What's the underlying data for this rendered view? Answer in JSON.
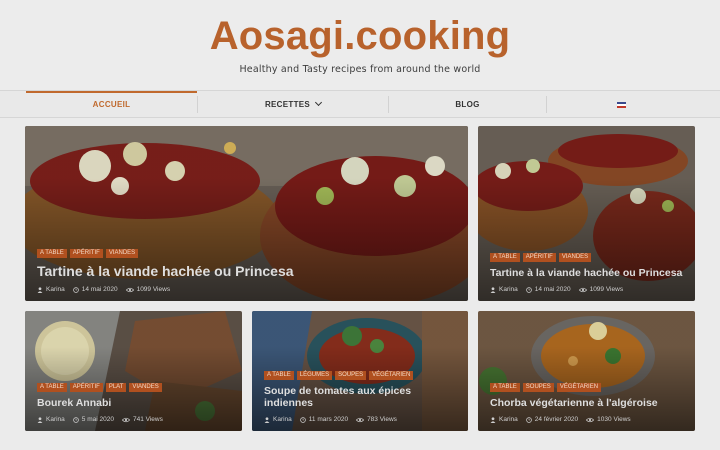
{
  "site": {
    "title": "Aosagi.cooking",
    "tagline": "Healthy and Tasty recipes from around the world"
  },
  "nav": {
    "items": [
      {
        "label": "ACCUEIL",
        "active": true
      },
      {
        "label": "RECETTES",
        "has_dropdown": true
      },
      {
        "label": "BLOG"
      },
      {
        "label": "",
        "icon": "uk-flag-icon"
      }
    ]
  },
  "posts": [
    {
      "tags": [
        "A TABLE",
        "APÉRITIF",
        "VIANDES"
      ],
      "title": "Tartine à la viande hachée ou Princesa",
      "author": "Karina",
      "date": "14 mai 2020",
      "views": "1099 Views"
    },
    {
      "tags": [
        "A TABLE",
        "APÉRITIF",
        "VIANDES"
      ],
      "title": "Tartine à la viande hachée ou Princesa",
      "author": "Karina",
      "date": "14 mai 2020",
      "views": "1099 Views"
    },
    {
      "tags": [
        "A TABLE",
        "APÉRITIF",
        "PLAT",
        "VIANDES"
      ],
      "title": "Bourek Annabi",
      "author": "Karina",
      "date": "5 mai 2020",
      "views": "741 Views"
    },
    {
      "tags": [
        "A TABLE",
        "LÉGUMES",
        "SOUPES",
        "VÉGÉTARIEN"
      ],
      "title": "Soupe de tomates aux épices indiennes",
      "author": "Karina",
      "date": "11 mars 2020",
      "views": "783 Views"
    },
    {
      "tags": [
        "A TABLE",
        "SOUPES",
        "VÉGÉTARIEN"
      ],
      "title": "Chorba végétarienne à l'algéroise",
      "author": "Karina",
      "date": "24 février 2020",
      "views": "1030 Views"
    }
  ],
  "colors": {
    "brand": "#b8622c",
    "tag_bg": "#b0501f"
  }
}
